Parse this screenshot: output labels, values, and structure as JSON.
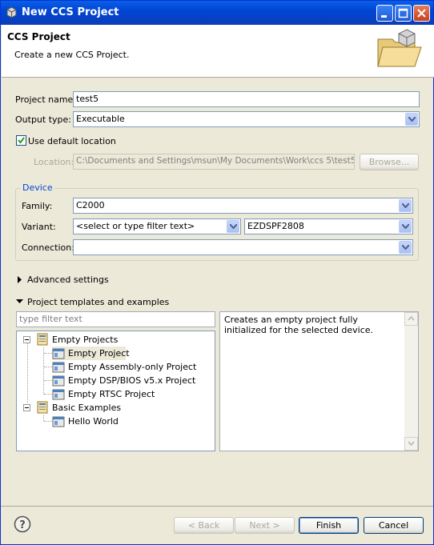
{
  "window": {
    "title": "New CCS Project"
  },
  "header": {
    "title": "CCS Project",
    "description": "Create a new CCS Project."
  },
  "form": {
    "project_name_label": "Project name:",
    "project_name_value": "test5",
    "output_type_label": "Output type:",
    "output_type_value": "Executable",
    "use_default_label": "Use default location",
    "use_default_checked": true,
    "location_label": "Location:",
    "location_value": "C:\\Documents and Settings\\msun\\My Documents\\Work\\ccs 5\\test5",
    "browse_label": "Browse..."
  },
  "device": {
    "group_title": "Device",
    "family_label": "Family:",
    "family_value": "C2000",
    "variant_label": "Variant:",
    "variant_filter_value": "<select or type filter text>",
    "variant_value": "EZDSPF2808",
    "connection_label": "Connection:",
    "connection_value": ""
  },
  "advanced": {
    "label": "Advanced settings"
  },
  "templates": {
    "label": "Project templates and examples",
    "filter_placeholder": "type filter text",
    "tree": [
      {
        "label": "Empty Projects",
        "children": [
          "Empty Project",
          "Empty Assembly-only Project",
          "Empty DSP/BIOS v5.x Project",
          "Empty RTSC Project"
        ]
      },
      {
        "label": "Basic Examples",
        "children": [
          "Hello World"
        ]
      }
    ],
    "selected": "Empty Project",
    "description": "Creates an empty project fully initialized for the selected device."
  },
  "footer": {
    "back_label": "< Back",
    "next_label": "Next >",
    "finish_label": "Finish",
    "cancel_label": "Cancel"
  },
  "colors": {
    "accent": "#0046D5",
    "title_bar": "#0A5FE6",
    "dialog_bg": "#ECE9D8"
  }
}
